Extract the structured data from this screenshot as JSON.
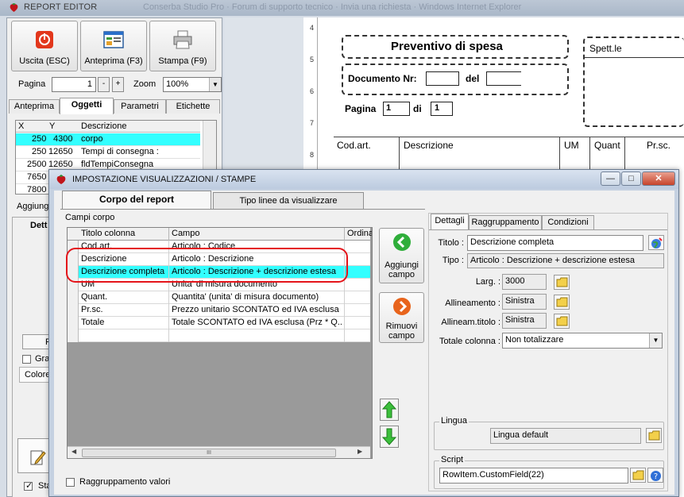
{
  "editor": {
    "title": "REPORT EDITOR",
    "ghost_title": "Conserba Studio Pro · Forum di supporto tecnico · Invia una richiesta · Windows Internet Explorer",
    "toolbar": {
      "exit": "Uscita (ESC)",
      "preview": "Anteprima (F3)",
      "print": "Stampa (F9)"
    },
    "page_label": "Pagina",
    "page_value": "1",
    "spin_minus": "-",
    "spin_plus": "+",
    "zoom_label": "Zoom",
    "zoom_value": "100%",
    "tabs": [
      "Anteprima",
      "Oggetti",
      "Parametri",
      "Etichette"
    ],
    "grid": {
      "headers": [
        "X",
        "Y",
        "Descrizione"
      ],
      "rows": [
        {
          "x": "250",
          "y": "4300",
          "d": "corpo"
        },
        {
          "x": "250",
          "y": "12650",
          "d": "Tempi di consegna :"
        },
        {
          "x": "2500",
          "y": "12650",
          "d": "fldTempiConsegna"
        },
        {
          "x": "7650",
          "y": "",
          "d": ""
        },
        {
          "x": "7800",
          "y": "",
          "d": ""
        }
      ]
    },
    "fragments": {
      "aggiungi": "Aggiung",
      "dett": "Dett",
      "fo": "Fo",
      "gra": "Gras",
      "colore": "Colore",
      "sta": "Sta"
    }
  },
  "report": {
    "title": "Preventivo di spesa",
    "spett": "Spett.le",
    "documento": "Documento Nr:",
    "del": "del",
    "pagina": "Pagina",
    "pagina_val": "1",
    "di": "di",
    "di_val": "1",
    "cols": [
      "Cod.art.",
      "Descrizione",
      "UM",
      "Quant",
      "Pr.sc."
    ],
    "ruler": [
      "4",
      "5",
      "6",
      "7",
      "8"
    ]
  },
  "dialog": {
    "title": "IMPOSTAZIONE VISUALIZZAZIONI / STAMPE",
    "win_min": "—",
    "win_max": "□",
    "win_close": "✕",
    "tabs": [
      "Corpo del report",
      "Tipo linee da visualizzare"
    ],
    "campi_label": "Campi corpo",
    "grid": {
      "headers": [
        "Titolo colonna",
        "Campo",
        "Ordina"
      ],
      "rows": [
        {
          "title": "Cod.art.",
          "field": "Articolo : Codice"
        },
        {
          "title": "Descrizione",
          "field": "Articolo : Descrizione"
        },
        {
          "title": "Descrizione completa",
          "field": "Articolo : Descrizione + descrizione estesa",
          "selected": true
        },
        {
          "title": "UM",
          "field": "Unita' di misura documento"
        },
        {
          "title": "Quant.",
          "field": "Quantita' (unita' di misura documento)"
        },
        {
          "title": "Pr.sc.",
          "field": "Prezzo unitario SCONTATO ed IVA esclusa"
        },
        {
          "title": "Totale",
          "field": "Totale SCONTATO ed IVA esclusa (Prz * Q..."
        },
        {
          "title": "",
          "field": ""
        }
      ],
      "scroll_grip": "III"
    },
    "add_button": [
      "Aggiungi",
      "campo"
    ],
    "remove_button": [
      "Rimuovi",
      "campo"
    ],
    "group_values": "Raggruppamento valori",
    "right": {
      "tabs": [
        "Dettagli",
        "Raggruppamento",
        "Condizioni"
      ],
      "titolo_label": "Titolo :",
      "titolo_value": "Descrizione completa",
      "tipo_label": "Tipo :",
      "tipo_value": "Articolo : Descrizione + descrizione estesa",
      "larg_label": "Larg. :",
      "larg_value": "3000",
      "allineamento_label": "Allineamento :",
      "allineamento_value": "Sinistra",
      "allineam_titolo_label": "Allineam.titolo :",
      "allineam_titolo_value": "Sinistra",
      "totale_label": "Totale colonna :",
      "totale_value": "Non totalizzare",
      "lingua_group": "Lingua",
      "lingua_value": "Lingua default",
      "script_group": "Script",
      "script_value": "RowItem.CustomField(22)"
    }
  },
  "colors": {
    "selection": "#33ffff",
    "highlight_border": "#e4141a",
    "green_arrow": "#2fae3a",
    "orange_arrow": "#e8641c"
  }
}
